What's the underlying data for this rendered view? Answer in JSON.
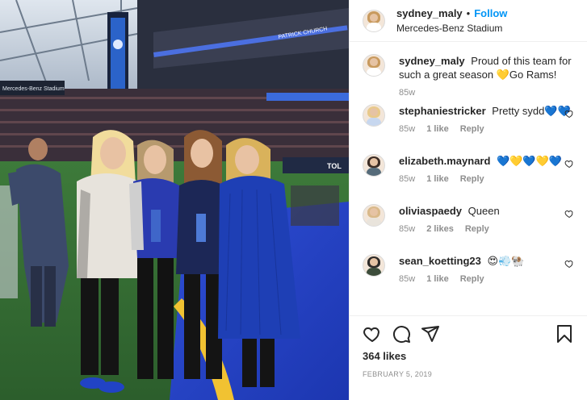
{
  "post": {
    "author": "sydney_maly",
    "separator": "•",
    "follow_label": "Follow",
    "location": "Mercedes-Benz Stadium",
    "caption_author": "sydney_maly",
    "caption_text": "Proud of this team for such a great season 💛Go Rams!",
    "caption_time": "85w"
  },
  "comments": [
    {
      "username": "stephaniestricker",
      "text": "Pretty sydd💙💙",
      "time": "85w",
      "likes": "1 like",
      "reply": "Reply",
      "avatar_hair": "#e8c98a",
      "avatar_body": "#c7d7ef"
    },
    {
      "username": "elizabeth.maynard",
      "text": "💙💛💙💛💙",
      "time": "85w",
      "likes": "1 like",
      "reply": "Reply",
      "avatar_hair": "#3b2c24",
      "avatar_body": "#556b7a"
    },
    {
      "username": "oliviaspaedy",
      "text": "Queen",
      "time": "85w",
      "likes": "2 likes",
      "reply": "Reply",
      "avatar_hair": "#d9b98a",
      "avatar_body": "#e9e4dc"
    },
    {
      "username": "sean_koetting23",
      "text": "😍💨🐏",
      "time": "85w",
      "likes": "1 like",
      "reply": "Reply",
      "avatar_hair": "#2d2a28",
      "avatar_body": "#3c4c3a"
    }
  ],
  "footer": {
    "likes": "364 likes",
    "date": "FEBRUARY 5, 2019"
  },
  "photo": {
    "banner_text": "PATRICK CHURCH",
    "scoreboard_text": "Mercedes-Benz Stadium",
    "sign_text": "TOL"
  },
  "colors": {
    "accent": "#0095f6",
    "text": "#262626",
    "muted": "#8e8e8e",
    "border": "#efefef"
  },
  "icons": [
    "heart-icon",
    "comment-icon",
    "share-icon",
    "bookmark-icon"
  ]
}
